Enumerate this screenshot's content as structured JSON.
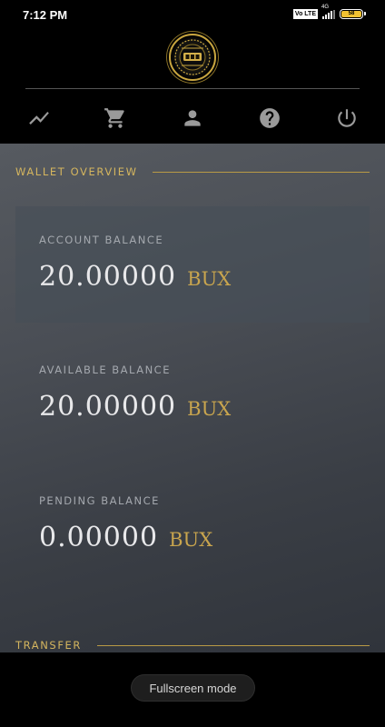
{
  "status_bar": {
    "time": "7:12 PM",
    "volte": "Vo LTE",
    "network": "4G",
    "battery": "58"
  },
  "nav": [
    {
      "name": "chart-icon"
    },
    {
      "name": "cart-icon"
    },
    {
      "name": "person-icon"
    },
    {
      "name": "help-icon"
    },
    {
      "name": "power-icon"
    }
  ],
  "wallet": {
    "section_title": "WALLET OVERVIEW",
    "account": {
      "label": "ACCOUNT BALANCE",
      "value": "20.00000",
      "unit": "BUX"
    },
    "available": {
      "label": "AVAILABLE BALANCE",
      "value": "20.00000",
      "unit": "BUX"
    },
    "pending": {
      "label": "PENDING BALANCE",
      "value": "0.00000",
      "unit": "BUX"
    }
  },
  "transfer": {
    "section_title": "TRANSFER"
  },
  "fullscreen": {
    "label": "Fullscreen mode"
  },
  "colors": {
    "accent_gold": "#d4b55e",
    "nav_icon": "#9a9a9a",
    "background": "#000000"
  }
}
